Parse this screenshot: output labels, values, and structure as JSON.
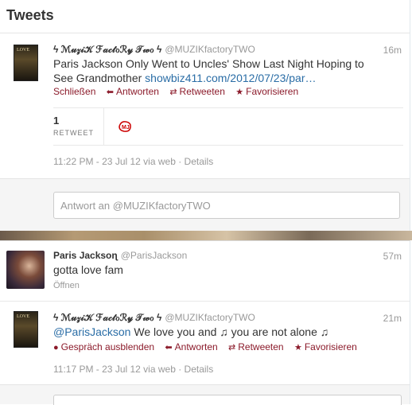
{
  "header": {
    "title": "Tweets"
  },
  "tweet1": {
    "name": "ϟ ℳ𝓊𝓏𝒾𝒦 ℱ𝒶𝒸𝓉ℴℛ𝓎 𝒯𝓌ℴ ϟ",
    "handle": "@MUZIKfactoryTWO",
    "time": "16m",
    "text": "Paris Jackson Only Went to Uncles' Show Last Night Hoping to See Grandmother ",
    "link": "showbiz411.com/2012/07/23/par…",
    "actions": {
      "close": "Schließen",
      "reply": "Antworten",
      "retweet": "Retweeten",
      "favorite": "Favorisieren"
    },
    "retweet_count": "1",
    "retweet_label": "RETWEET",
    "meta_time": "11:22 PM - 23 Jul 12 via web",
    "meta_sep": " · ",
    "details": "Details",
    "reply_placeholder": "Antwort an @MUZIKfactoryTWO",
    "avatar_text": "LOVE"
  },
  "tweet2": {
    "name": "Paris Jacksoɳ",
    "handle": "@ParisJackson",
    "time": "57m",
    "text": "gotta love fam",
    "open": "Öffnen"
  },
  "tweet3": {
    "name": "ϟ ℳ𝓊𝓏𝒾𝒦 ℱ𝒶𝒸𝓉ℴℛ𝓎 𝒯𝓌ℴ ϟ",
    "handle": "@MUZIKfactoryTWO",
    "time": "21m",
    "mention": "@ParisJackson",
    "text": " We love you and ♫ you are not alone ♫",
    "actions": {
      "hide": "Gespräch ausblenden",
      "reply": "Antworten",
      "retweet": "Retweeten",
      "favorite": "Favorisieren"
    },
    "meta_time": "11:17 PM - 23 Jul 12 via web",
    "meta_sep": " · ",
    "details": "Details",
    "avatar_text": "LOVE"
  },
  "colors": {
    "link": "#2a6da6",
    "action": "#8b1a2a"
  }
}
